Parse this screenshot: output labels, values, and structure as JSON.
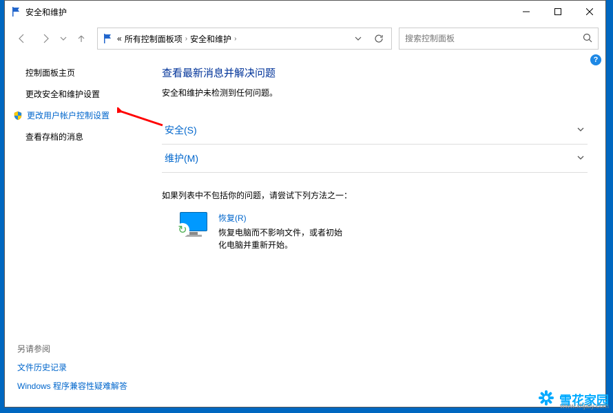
{
  "window": {
    "title": "安全和维护"
  },
  "nav": {
    "breadcrumb_prefix": "«",
    "crumb1": "所有控制面板项",
    "crumb2": "安全和维护"
  },
  "search": {
    "placeholder": "搜索控制面板"
  },
  "sidebar": {
    "home": "控制面板主页",
    "change_sec": "更改安全和维护设置",
    "change_uac": "更改用户帐户控制设置",
    "view_archived": "查看存档的消息",
    "see_also": "另请参阅",
    "file_history": "文件历史记录",
    "compat_troubleshoot": "Windows 程序兼容性疑难解答"
  },
  "main": {
    "title": "查看最新消息并解决问题",
    "subtitle": "安全和维护未检测到任何问题。",
    "security_row": "安全(S)",
    "maintenance_row": "维护(M)",
    "further": "如果列表中不包括你的问题，请尝试下列方法之一：",
    "recover_title": "恢复(R)",
    "recover_desc": "恢复电脑而不影响文件，或者初始化电脑并重新开始。"
  },
  "help": "?",
  "watermark": {
    "text": "雪花家园",
    "sub": "www.xhjaty.com"
  }
}
